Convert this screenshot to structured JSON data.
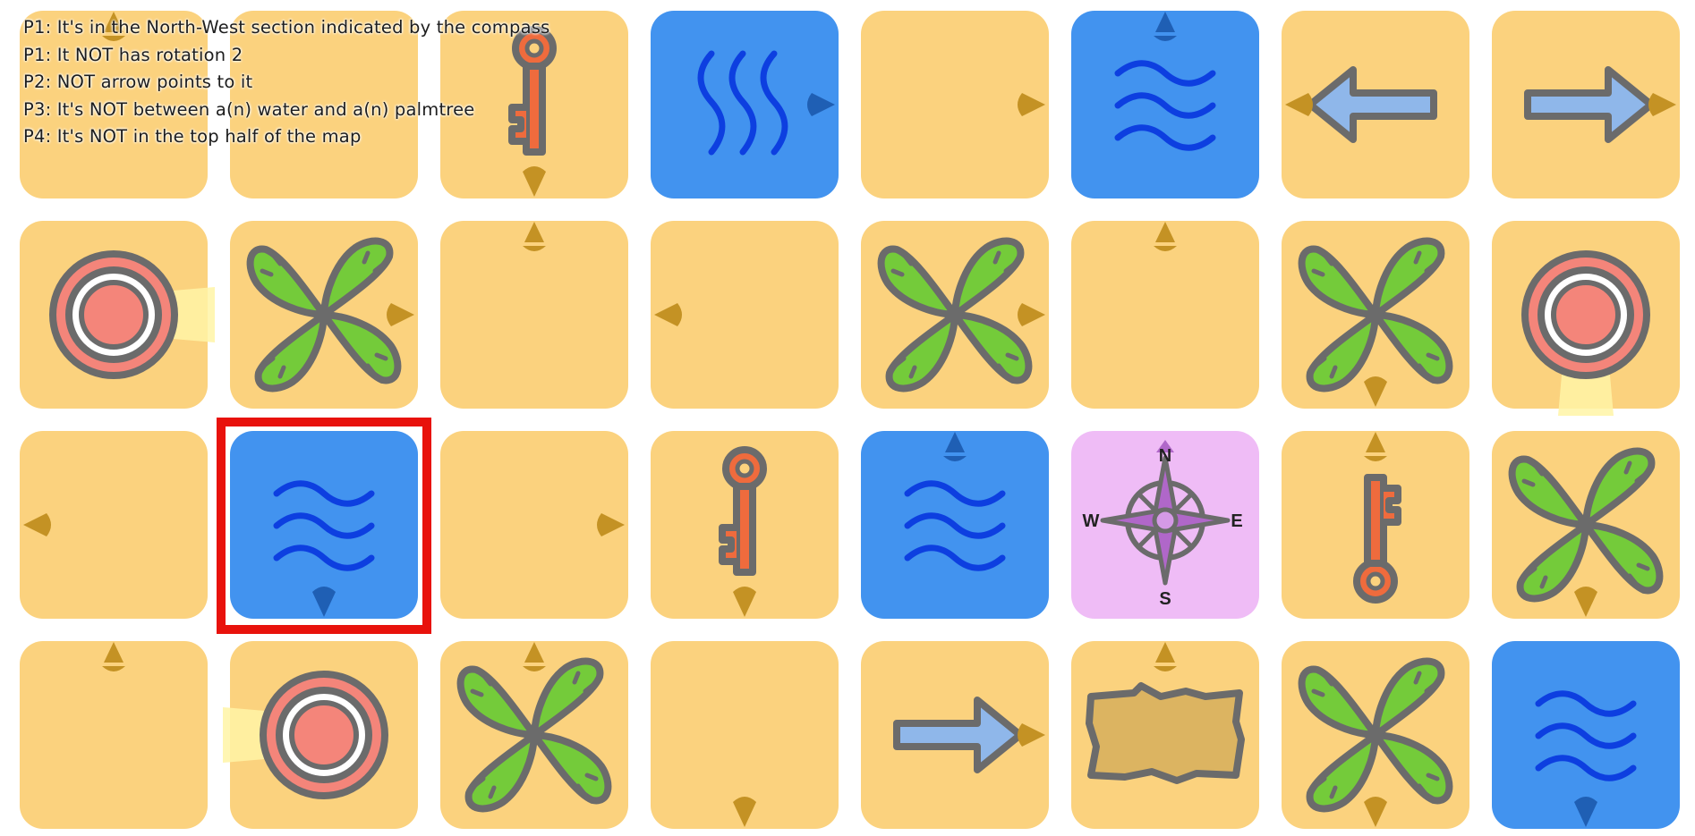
{
  "clues": [
    "P1: It's in the North-West section indicated by the compass",
    "P1: It NOT has rotation 2",
    "P2: NOT arrow points to it",
    "P3: It's NOT between a(n) water and a(n) palmtree",
    "P4: It's NOT in the top half of the map"
  ],
  "compass_labels": {
    "north": "N",
    "south": "S",
    "east": "E",
    "west": "W"
  },
  "colors": {
    "sand": "#fbd27e",
    "water": "#4293ef",
    "compass_bg": "#efbcf6",
    "marker": "#c49224",
    "water_marker": "#1f5fb4",
    "selection": "#e8120c"
  },
  "board": {
    "rows": 4,
    "cols": 8,
    "selected": {
      "row": 2,
      "col": 1
    },
    "tiles": [
      [
        {
          "type": "sand",
          "marker": "up"
        },
        {
          "type": "sand",
          "marker": "none"
        },
        {
          "type": "key",
          "marker": "down",
          "icon": "key-icon"
        },
        {
          "type": "water-vertical",
          "marker": "right",
          "icon": "water-waves-icon"
        },
        {
          "type": "sand",
          "marker": "right"
        },
        {
          "type": "water",
          "marker": "up",
          "icon": "water-waves-icon"
        },
        {
          "type": "arrow-left",
          "marker": "left",
          "icon": "arrow-left-icon"
        },
        {
          "type": "arrow-right",
          "marker": "right",
          "icon": "arrow-right-icon"
        }
      ],
      [
        {
          "type": "target",
          "marker": "none",
          "hint": "right",
          "icon": "target-icon"
        },
        {
          "type": "palmtree",
          "marker": "right",
          "icon": "palmtree-icon"
        },
        {
          "type": "sand",
          "marker": "up"
        },
        {
          "type": "sand",
          "marker": "left"
        },
        {
          "type": "palmtree",
          "marker": "right",
          "icon": "palmtree-icon"
        },
        {
          "type": "sand",
          "marker": "up"
        },
        {
          "type": "palmtree",
          "marker": "down",
          "icon": "palmtree-icon"
        },
        {
          "type": "target",
          "marker": "none",
          "hint": "down",
          "icon": "target-icon"
        }
      ],
      [
        {
          "type": "sand",
          "marker": "left"
        },
        {
          "type": "water",
          "marker": "down",
          "icon": "water-waves-icon"
        },
        {
          "type": "sand",
          "marker": "right"
        },
        {
          "type": "key",
          "marker": "down",
          "icon": "key-icon"
        },
        {
          "type": "water",
          "marker": "up",
          "icon": "water-waves-icon"
        },
        {
          "type": "compass",
          "marker": "none",
          "icon": "compass-icon"
        },
        {
          "type": "key-inverted",
          "marker": "up",
          "icon": "key-icon"
        },
        {
          "type": "palmtree",
          "marker": "down",
          "icon": "palmtree-icon"
        }
      ],
      [
        {
          "type": "sand",
          "marker": "up"
        },
        {
          "type": "target",
          "marker": "none",
          "hint": "left",
          "icon": "target-icon"
        },
        {
          "type": "palmtree",
          "marker": "up",
          "icon": "palmtree-icon"
        },
        {
          "type": "sand",
          "marker": "down"
        },
        {
          "type": "arrow-right",
          "marker": "right",
          "icon": "arrow-right-icon"
        },
        {
          "type": "map",
          "marker": "up",
          "icon": "treasure-map-icon"
        },
        {
          "type": "palmtree",
          "marker": "down",
          "icon": "palmtree-icon"
        },
        {
          "type": "water",
          "marker": "down",
          "icon": "water-waves-icon"
        }
      ]
    ]
  }
}
